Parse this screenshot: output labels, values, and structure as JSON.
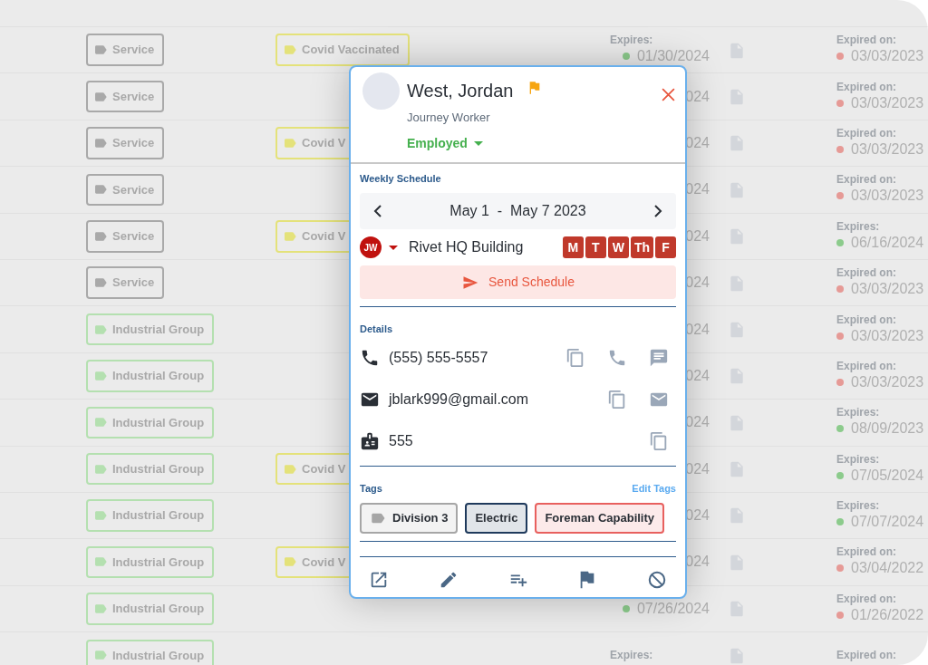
{
  "table": {
    "rows": [
      {
        "tag_1": {
          "label": "Service",
          "color": "#a9a9a9"
        },
        "tag_2": {
          "label": "Covid Vaccinated",
          "color": "#e4e27a"
        },
        "date": {
          "label": "Expires:",
          "color": "#8ccb8c",
          "value": "01/30/2024"
        },
        "date_2": {
          "label": "Expired on:",
          "color": "#e69a96",
          "value": "03/03/2023"
        }
      },
      {
        "tag_1": {
          "label": "Service",
          "color": "#a9a9a9"
        },
        "date": {
          "value": "024"
        },
        "date_2": {
          "label": "Expired on:",
          "color": "#e69a96",
          "value": "03/03/2023"
        }
      },
      {
        "tag_1": {
          "label": "Service",
          "color": "#a9a9a9"
        },
        "tag_2": {
          "label": "Covid V",
          "color": "#e4e27a"
        },
        "date": {
          "value": "024"
        },
        "date_2": {
          "label": "Expired on:",
          "color": "#e69a96",
          "value": "03/03/2023"
        }
      },
      {
        "tag_1": {
          "label": "Service",
          "color": "#a9a9a9"
        },
        "date": {
          "value": "024"
        },
        "date_2": {
          "label": "Expired on:",
          "color": "#e69a96",
          "value": "03/03/2023"
        }
      },
      {
        "tag_1": {
          "label": "Service",
          "color": "#a9a9a9"
        },
        "tag_2": {
          "label": "Covid V",
          "color": "#e4e27a"
        },
        "date": {
          "value": "024"
        },
        "date_2": {
          "label": "Expires:",
          "color": "#8ccb8c",
          "value": "06/16/2024"
        }
      },
      {
        "tag_1": {
          "label": "Service",
          "color": "#a9a9a9"
        },
        "date": {
          "value": "024"
        },
        "date_2": {
          "label": "Expired on:",
          "color": "#e69a96",
          "value": "03/03/2023"
        }
      },
      {
        "tag_1": {
          "label": "Industrial Group",
          "color": "#b4e0b0"
        },
        "date": {
          "value": "024"
        },
        "date_2": {
          "label": "Expired on:",
          "color": "#e69a96",
          "value": "03/03/2023"
        }
      },
      {
        "tag_1": {
          "label": "Industrial Group",
          "color": "#b4e0b0"
        },
        "date": {
          "value": "024"
        },
        "date_2": {
          "label": "Expired on:",
          "color": "#e69a96",
          "value": "03/03/2023"
        }
      },
      {
        "tag_1": {
          "label": "Industrial Group",
          "color": "#b4e0b0"
        },
        "date": {
          "value": "024"
        },
        "date_2": {
          "label": "Expires:",
          "color": "#8ccb8c",
          "value": "08/09/2023"
        }
      },
      {
        "tag_1": {
          "label": "Industrial Group",
          "color": "#b4e0b0"
        },
        "tag_2": {
          "label": "Covid V",
          "color": "#e4e27a"
        },
        "date": {
          "value": "024"
        },
        "date_2": {
          "label": "Expires:",
          "color": "#8ccb8c",
          "value": "07/05/2024"
        }
      },
      {
        "tag_1": {
          "label": "Industrial Group",
          "color": "#b4e0b0"
        },
        "date": {
          "value": "024"
        },
        "date_2": {
          "label": "Expires:",
          "color": "#8ccb8c",
          "value": "07/07/2024"
        }
      },
      {
        "tag_1": {
          "label": "Industrial Group",
          "color": "#b4e0b0"
        },
        "tag_2": {
          "label": "Covid V",
          "color": "#e4e27a"
        },
        "date": {
          "value": "024"
        },
        "date_2": {
          "label": "Expired on:",
          "color": "#e69a96",
          "value": "03/04/2022"
        }
      },
      {
        "tag_1": {
          "label": "Industrial Group",
          "color": "#b4e0b0"
        },
        "date": {
          "color": "#8ccb8c",
          "value": "07/26/2024"
        },
        "date_2": {
          "label": "Expired on:",
          "color": "#e69a96",
          "value": "01/26/2022"
        }
      },
      {
        "tag_1": {
          "label": "Industrial Group",
          "color": "#b4e0b0"
        },
        "date": {
          "label": "Expires:"
        },
        "date_2": {
          "label": "Expired on:"
        }
      }
    ]
  },
  "popup": {
    "name": "West, Jordan",
    "flagged": true,
    "role": "Journey Worker",
    "status": "Employed",
    "schedule": {
      "title": "Weekly Schedule",
      "range_start": "May 1",
      "separator": "-",
      "range_end": "May 7 2023",
      "initials": "JW",
      "location": "Rivet HQ Building",
      "days": [
        {
          "label": "M",
          "selected": true
        },
        {
          "label": "T",
          "selected": true
        },
        {
          "label": "W",
          "selected": true
        },
        {
          "label": "Th",
          "selected": true
        },
        {
          "label": "F",
          "selected": true
        }
      ],
      "send_button": "Send Schedule"
    },
    "details": {
      "title": "Details",
      "items": [
        {
          "kind": "phone",
          "value": "(555) 555-5557"
        },
        {
          "kind": "email",
          "value": "jblark999@gmail.com"
        },
        {
          "kind": "id",
          "value": "555"
        }
      ]
    },
    "tags": {
      "title": "Tags",
      "edit_link": "Edit Tags",
      "items": [
        {
          "label": "Division 3",
          "color": "#a6a6a6",
          "icon": true
        },
        {
          "label": "Electric",
          "color": "#1f3a5c",
          "icon": false
        },
        {
          "label": "Foreman Capability",
          "color": "#e8605e",
          "icon": false
        }
      ]
    }
  }
}
